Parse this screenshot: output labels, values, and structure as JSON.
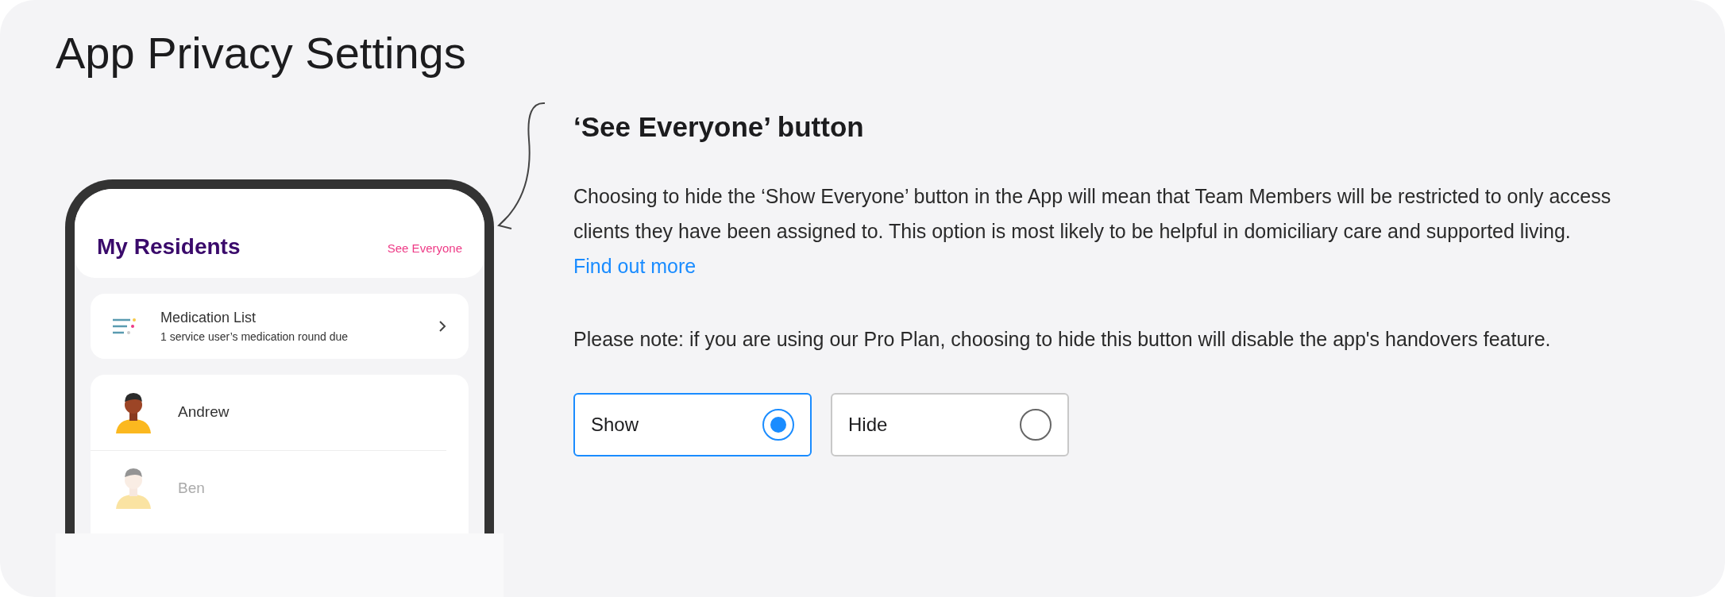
{
  "title": "App Privacy Settings",
  "phone": {
    "header": "My Residents",
    "see_everyone": "See Everyone",
    "medication": {
      "title": "Medication List",
      "subtitle": "1 service user’s medication round due"
    },
    "residents": [
      {
        "name": "Andrew",
        "faded": false
      },
      {
        "name": "Ben",
        "faded": true
      }
    ]
  },
  "setting": {
    "heading": "‘See Everyone’ button",
    "description": "Choosing to hide the ‘Show Everyone’ button in the App will mean that Team Members will be restricted to only access clients they have been assigned to. This option is most likely to be helpful in domiciliary care and supported living.",
    "link": "Find out more",
    "note": "Please note: if you are using our Pro Plan, choosing to hide this button will disable the app's handovers feature.",
    "options": [
      {
        "label": "Show",
        "selected": true
      },
      {
        "label": "Hide",
        "selected": false
      }
    ]
  }
}
